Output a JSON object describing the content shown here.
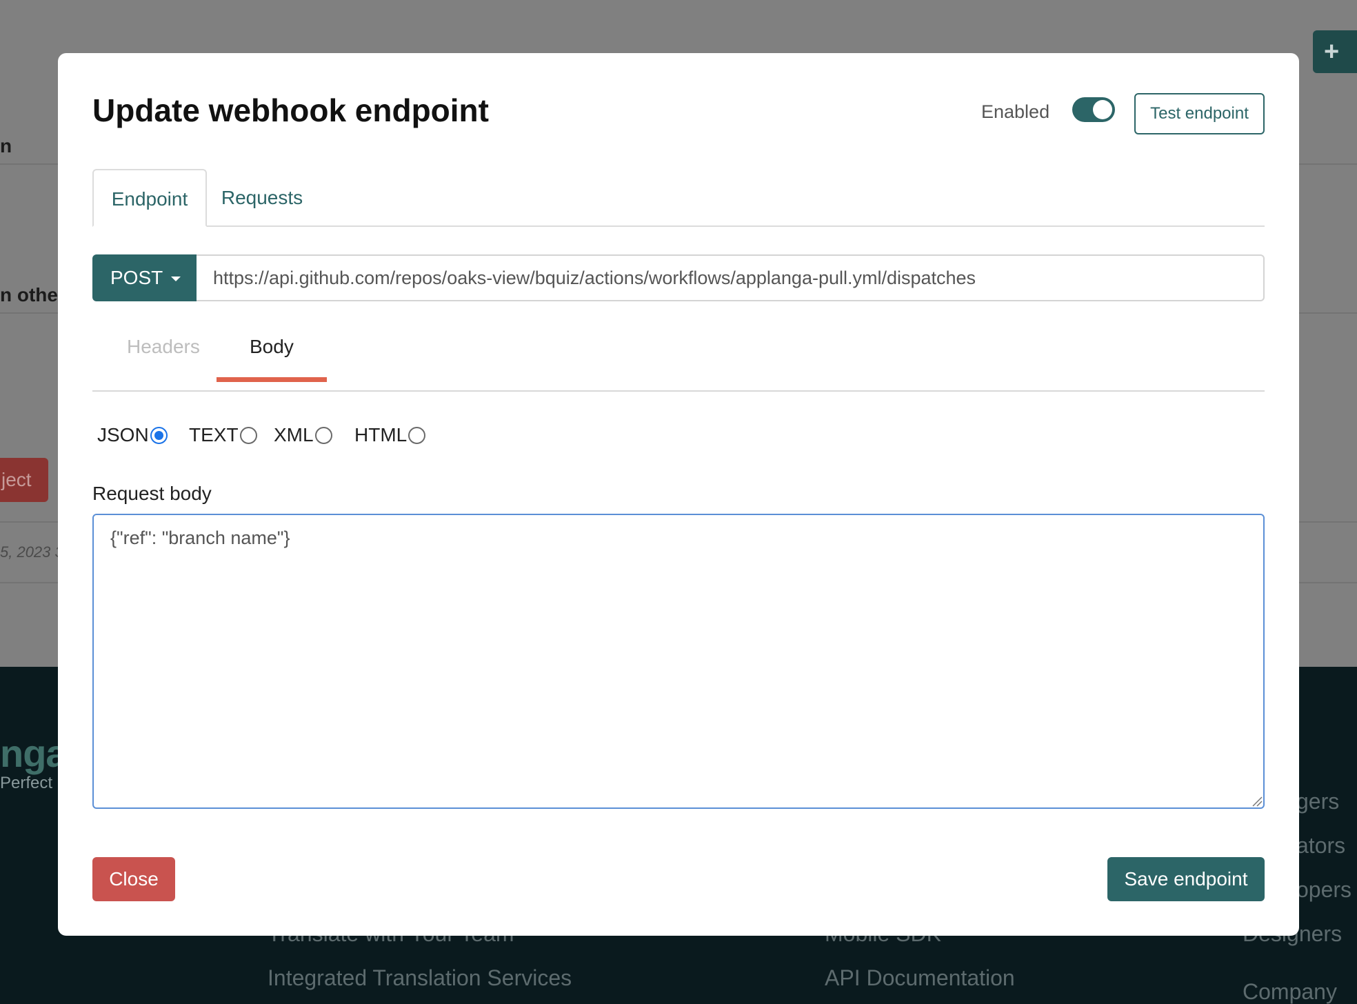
{
  "background": {
    "fragment_1": "n",
    "fragment_2": "n other",
    "reject_fragment": "ject",
    "date_fragment": "5, 2023 3",
    "add_fragment": "+",
    "logo_fragment": "nga",
    "tagline_fragment": "Perfect",
    "footer_links": {
      "integrated": "Integrated Translation Services",
      "translate_team": "Translate with Your Team",
      "api_docs": "API Documentation",
      "mobile_sdk": "Mobile SDK",
      "managers": "gers",
      "translators": "ators",
      "developers": "opers",
      "designers": "Designers",
      "company": "Company"
    }
  },
  "modal": {
    "title": "Update webhook endpoint",
    "enabled_label": "Enabled",
    "enabled": true,
    "test_button": "Test endpoint",
    "tabs": [
      {
        "label": "Endpoint",
        "active": true
      },
      {
        "label": "Requests",
        "active": false
      }
    ],
    "method": "POST",
    "url": "https://api.github.com/repos/oaks-view/bquiz/actions/workflows/applanga-pull.yml/dispatches",
    "subtabs": [
      {
        "label": "Headers",
        "active": false
      },
      {
        "label": "Body",
        "active": true
      }
    ],
    "body_formats": [
      {
        "label": "JSON",
        "checked": true
      },
      {
        "label": "TEXT",
        "checked": false
      },
      {
        "label": "XML",
        "checked": false
      },
      {
        "label": "HTML",
        "checked": false
      }
    ],
    "request_body_label": "Request body",
    "request_body": "{\"ref\": \"branch name\"}",
    "close_button": "Close",
    "save_button": "Save endpoint"
  },
  "colors": {
    "primary": "#2c6567",
    "danger": "#c9534f",
    "accent_underline": "#e0634c",
    "radio_checked": "#1a73e8"
  }
}
